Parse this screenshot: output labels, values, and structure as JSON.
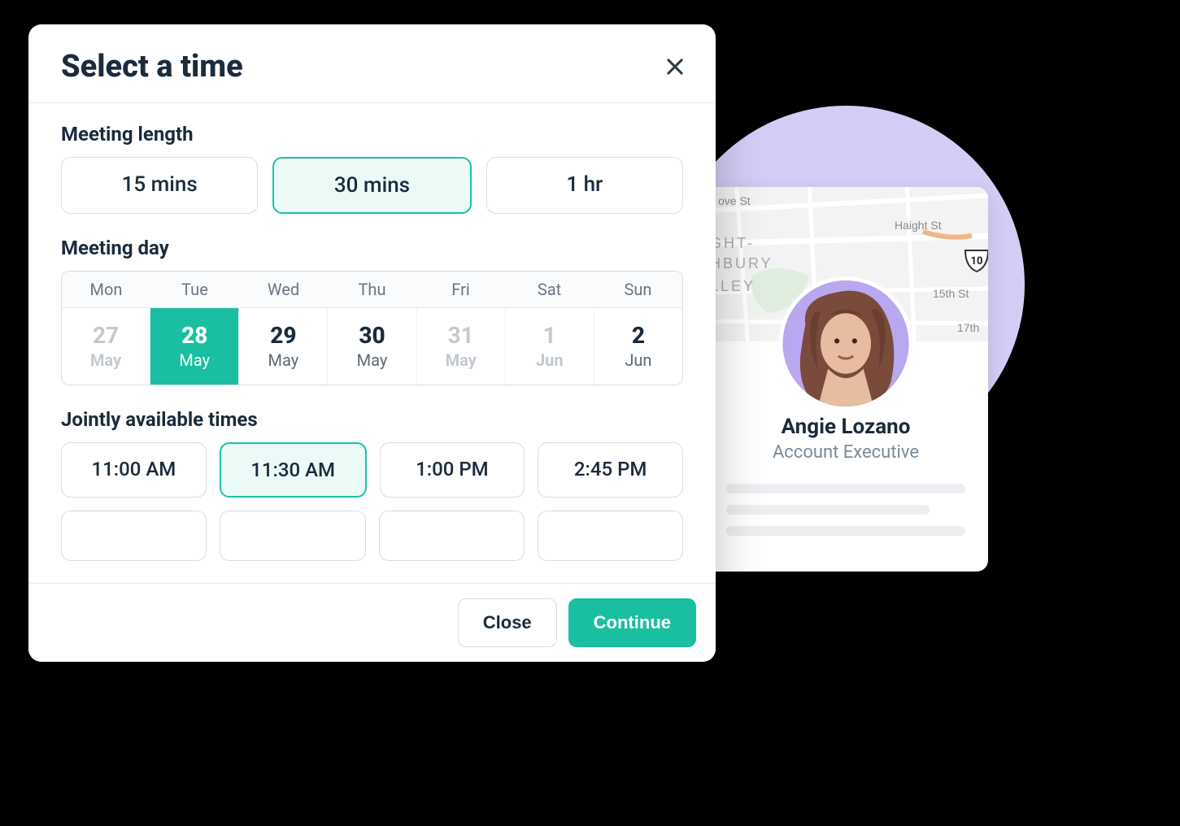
{
  "modal": {
    "title": "Select a time",
    "meeting_length": {
      "label": "Meeting length",
      "options": [
        {
          "label": "15 mins",
          "selected": false
        },
        {
          "label": "30 mins",
          "selected": true
        },
        {
          "label": "1 hr",
          "selected": false
        }
      ]
    },
    "meeting_day": {
      "label": "Meeting day",
      "dow": [
        "Mon",
        "Tue",
        "Wed",
        "Thu",
        "Fri",
        "Sat",
        "Sun"
      ],
      "days": [
        {
          "num": "27",
          "month": "May",
          "disabled": true,
          "selected": false
        },
        {
          "num": "28",
          "month": "May",
          "disabled": false,
          "selected": true
        },
        {
          "num": "29",
          "month": "May",
          "disabled": false,
          "selected": false
        },
        {
          "num": "30",
          "month": "May",
          "disabled": false,
          "selected": false
        },
        {
          "num": "31",
          "month": "May",
          "disabled": true,
          "selected": false
        },
        {
          "num": "1",
          "month": "Jun",
          "disabled": true,
          "selected": false
        },
        {
          "num": "2",
          "month": "Jun",
          "disabled": false,
          "selected": false
        }
      ]
    },
    "available_times": {
      "label": "Jointly available times",
      "slots": [
        {
          "label": "11:00 AM",
          "selected": false
        },
        {
          "label": "11:30 AM",
          "selected": true
        },
        {
          "label": "1:00 PM",
          "selected": false
        },
        {
          "label": "2:45 PM",
          "selected": false
        }
      ]
    },
    "footer": {
      "close_label": "Close",
      "continue_label": "Continue"
    }
  },
  "profile": {
    "name": "Angie Lozano",
    "title": "Account Executive",
    "map_labels": {
      "grove": "ove St",
      "haight": "Haight St",
      "fifteenth": "15th St",
      "seventeenth": "17th",
      "neigh1": "GHT-",
      "neigh2": "HBURY",
      "valley": "LLEY",
      "highway": "10"
    }
  }
}
